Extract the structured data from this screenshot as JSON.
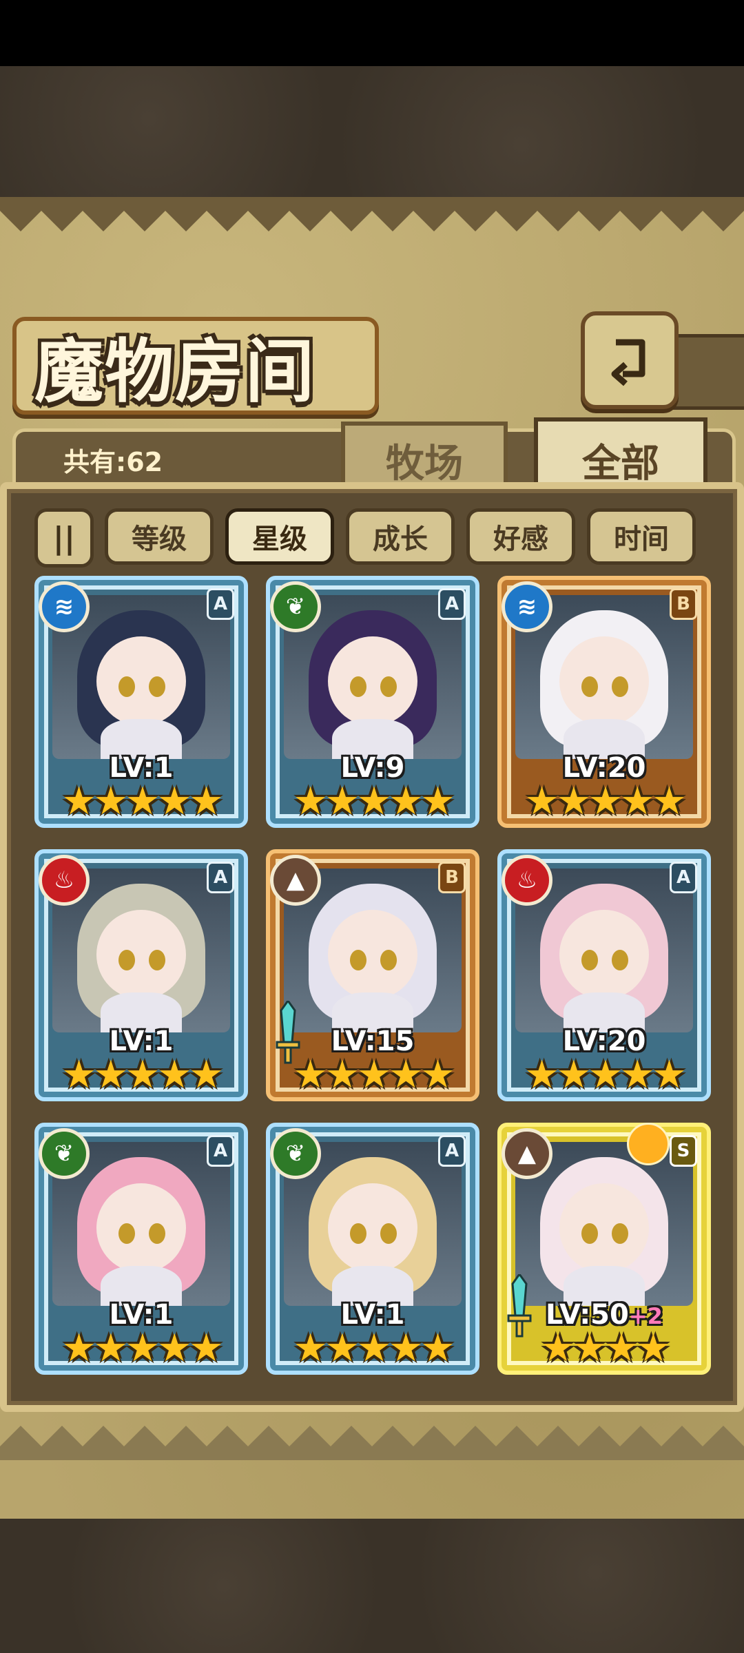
{
  "screen": {
    "title": "魔物房间",
    "count_label": "共有:62",
    "tabs": [
      {
        "label": "牧场",
        "active": false
      },
      {
        "label": "全部",
        "active": true
      }
    ],
    "sort_toggle": "||",
    "sort_options": [
      {
        "label": "等级",
        "active": false
      },
      {
        "label": "星级",
        "active": true
      },
      {
        "label": "成长",
        "active": false
      },
      {
        "label": "好感",
        "active": false
      },
      {
        "label": "时间",
        "active": false
      }
    ]
  },
  "monsters": [
    {
      "element": "water",
      "grade": "A",
      "level": "LV:1",
      "stars": 5,
      "equipped_icon": false
    },
    {
      "element": "grass",
      "grade": "A",
      "level": "LV:9",
      "stars": 5,
      "equipped_icon": false
    },
    {
      "element": "water",
      "grade": "B",
      "level": "LV:20",
      "stars": 5,
      "equipped_icon": false
    },
    {
      "element": "fire",
      "grade": "A",
      "level": "LV:1",
      "stars": 5,
      "equipped_icon": false
    },
    {
      "element": "earth",
      "grade": "B",
      "level": "LV:15",
      "stars": 5,
      "equipped_icon": "sword"
    },
    {
      "element": "fire",
      "grade": "A",
      "level": "LV:20",
      "stars": 5,
      "equipped_icon": false
    },
    {
      "element": "grass",
      "grade": "A",
      "level": "LV:1",
      "stars": 5,
      "equipped_icon": false
    },
    {
      "element": "grass",
      "grade": "A",
      "level": "LV:1",
      "stars": 5,
      "equipped_icon": false
    },
    {
      "element": "earth",
      "grade": "S",
      "level": "LV:50",
      "level_bonus": "+2",
      "stars": 4,
      "equipped_icon": "sword"
    }
  ],
  "colors": {
    "parchment": "#b8a56c",
    "panel": "#5b4b32",
    "star": "#ffc21c",
    "tier_A_frame": "#aee0ff",
    "tier_B_frame": "#f6c074",
    "tier_S_frame": "#fff07a"
  },
  "icons": {
    "back": "return-arrow-icon",
    "water": "water-wave-icon",
    "grass": "leaf-icon",
    "fire": "flame-icon",
    "earth": "mountain-icon",
    "sword": "sword-icon",
    "star": "star-icon"
  }
}
